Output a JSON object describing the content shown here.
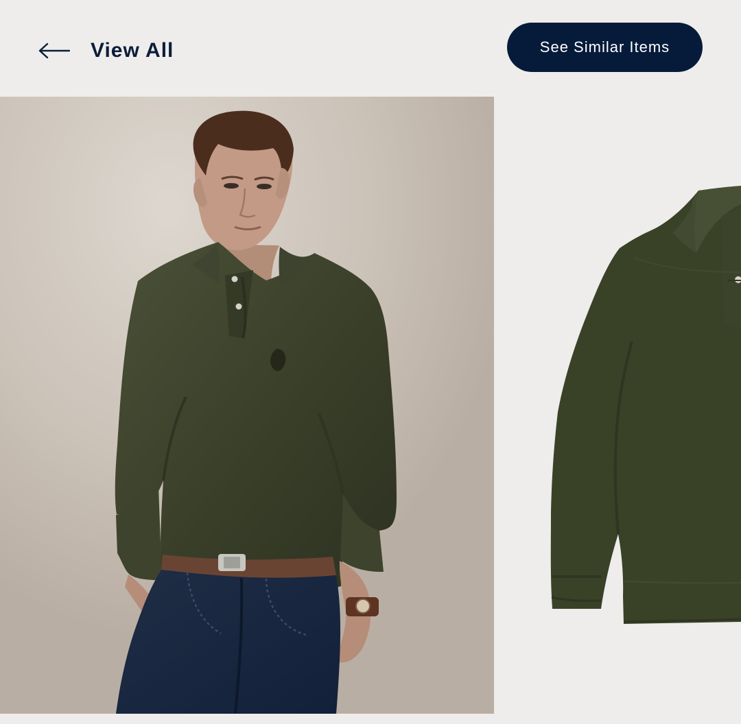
{
  "header": {
    "back_label": "View All",
    "back_icon": "arrow-left-icon",
    "similar_label": "See Similar Items"
  },
  "gallery": {
    "images": [
      {
        "kind": "model-photo",
        "description_icon": "photo-model-wearing-olive-polo"
      },
      {
        "kind": "product-flat",
        "description_icon": "photo-olive-polo-flat"
      }
    ]
  },
  "colors": {
    "navy": "#061b3a",
    "page_bg": "#efedeb",
    "olive": "#3b4129"
  }
}
